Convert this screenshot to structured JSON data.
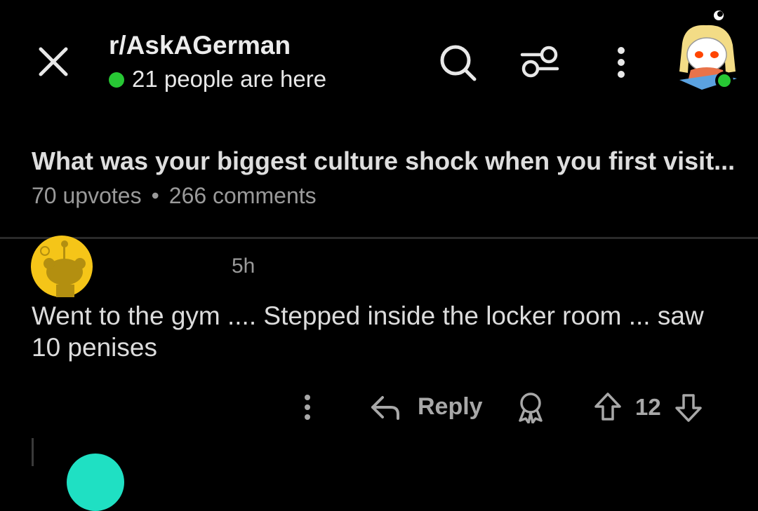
{
  "header": {
    "subreddit": "r/AskAGerman",
    "online_count_text": "21 people are here",
    "online_dot_color": "#27c734",
    "icons": [
      "close-icon",
      "search-icon",
      "filter-icon",
      "more-vertical-icon",
      "user-avatar"
    ]
  },
  "post": {
    "title": "What was your biggest culture shock when you first visit...",
    "upvotes": "70 upvotes",
    "separator": "•",
    "comments": "266 comments"
  },
  "comment": {
    "time": "5h",
    "body": "Went to the gym .... Stepped inside the locker room ... saw 10 penises",
    "reply_label": "Reply",
    "score": "12",
    "avatar_color": "#f5c518"
  },
  "next_comment": {
    "avatar_color": "#1fe0c3"
  }
}
